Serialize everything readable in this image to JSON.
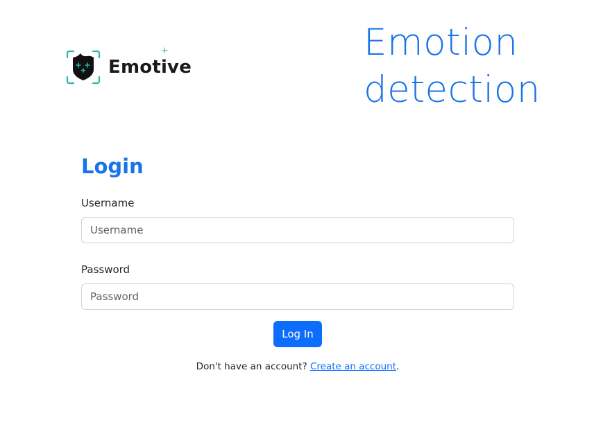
{
  "brand": {
    "name": "Emotive",
    "logo_icon": "shield-face-icon",
    "accent_color": "#2bb5a8"
  },
  "hero": {
    "title_line1": "Emotion",
    "title_line2": "detection"
  },
  "login": {
    "heading": "Login",
    "username_label": "Username",
    "username_placeholder": "Username",
    "username_value": "",
    "password_label": "Password",
    "password_placeholder": "Password",
    "password_value": "",
    "submit_label": "Log In",
    "signup_prompt": "Don't have an account?",
    "signup_link": "Create an account",
    "signup_suffix": "."
  },
  "colors": {
    "heading_blue": "#1a73e8",
    "primary_button": "#0d6efd"
  }
}
